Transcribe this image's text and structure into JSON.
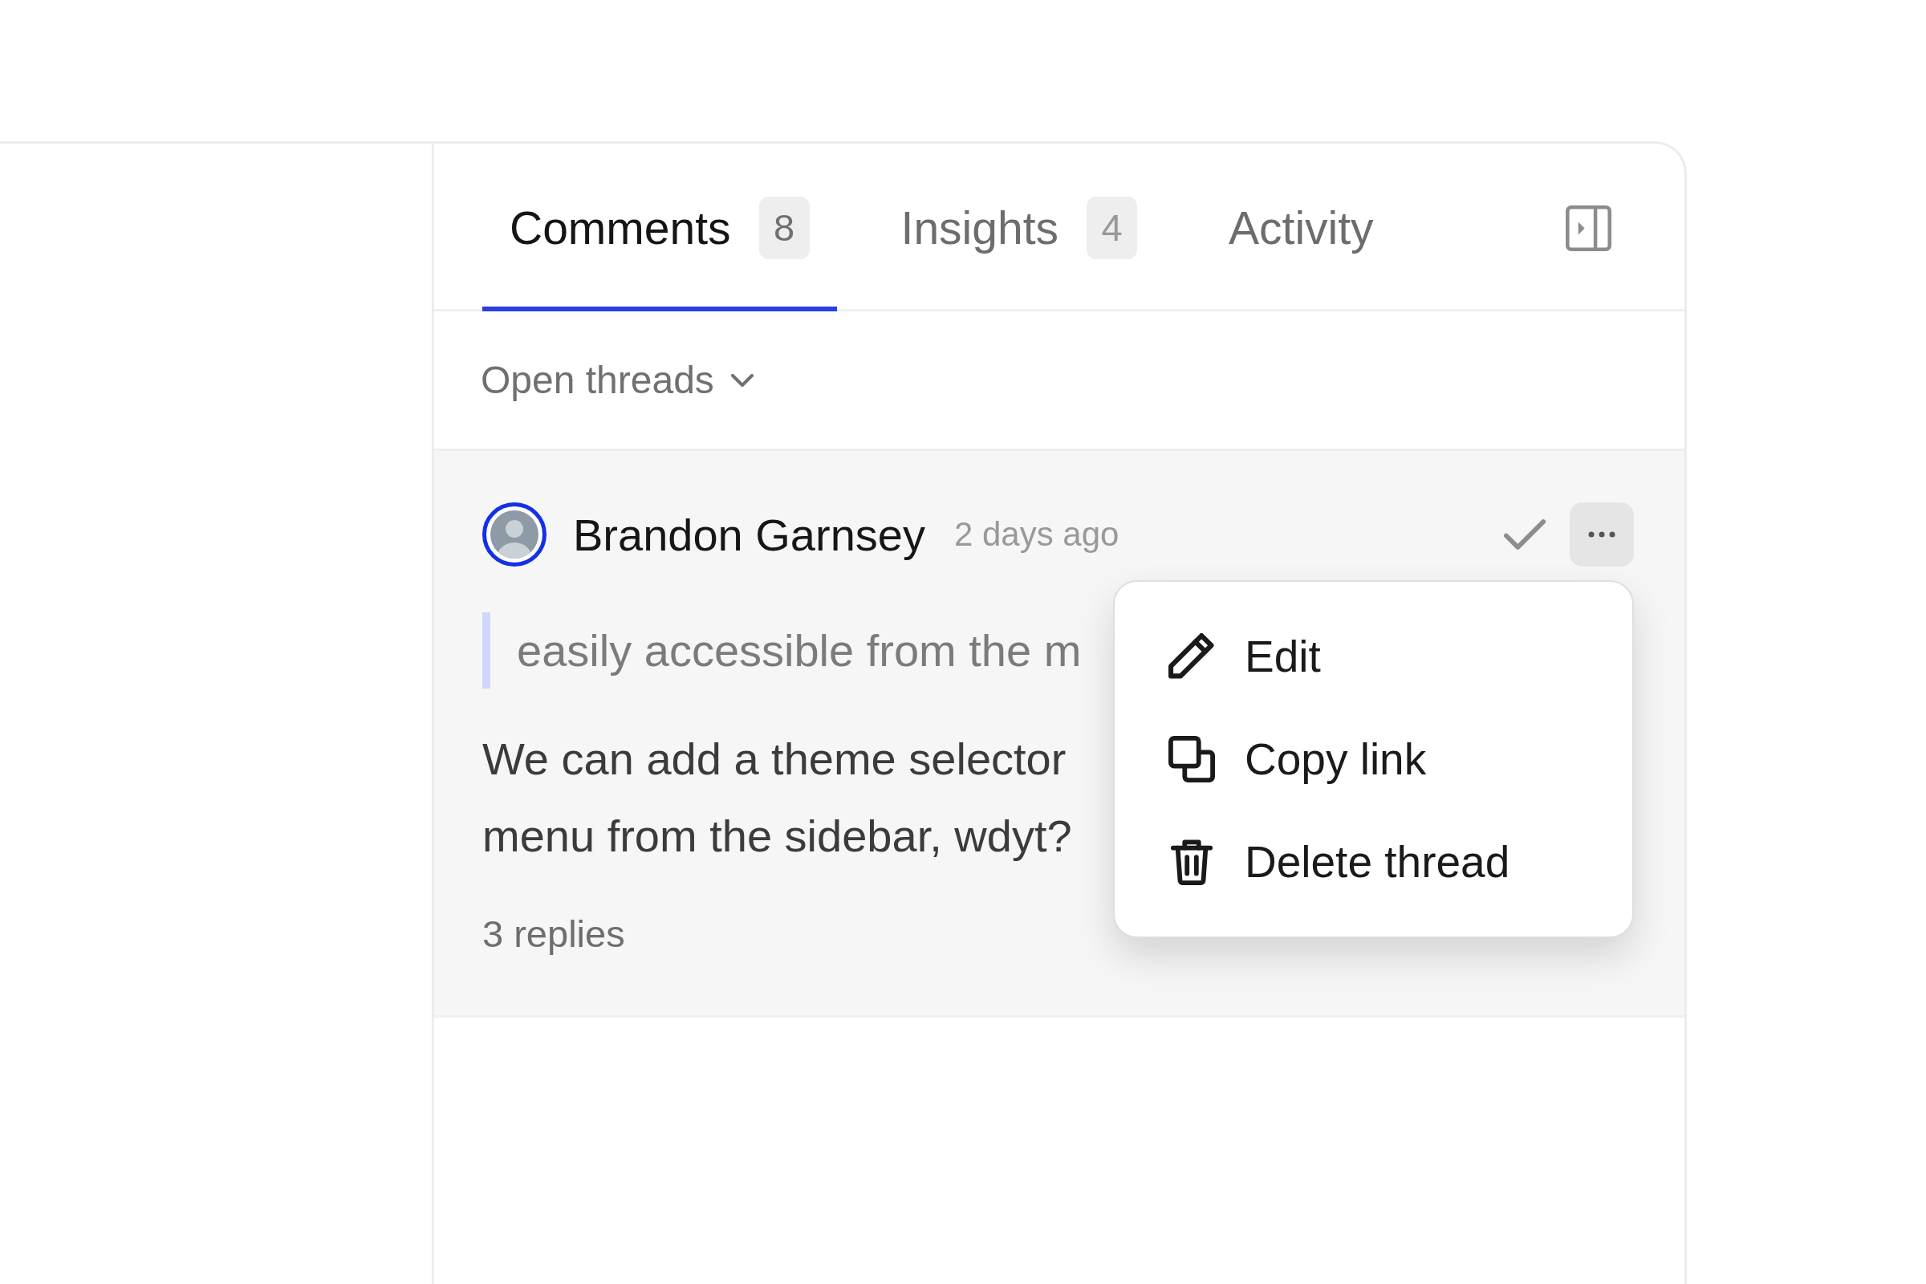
{
  "panel": {
    "tabs": [
      {
        "label": "Comments",
        "count": "8",
        "selected": true
      },
      {
        "label": "Insights",
        "count": "4",
        "selected": false
      },
      {
        "label": "Activity",
        "selected": false
      }
    ]
  },
  "filter": {
    "label": "Open threads"
  },
  "thread": {
    "author": "Brandon Garnsey",
    "time": "2 days ago",
    "quote": "easily accessible from the m",
    "body_lines": [
      "We can add a theme selector",
      "menu from the sidebar, wdyt?"
    ],
    "replies": "3 replies",
    "menu_open": true
  },
  "menu": {
    "items": [
      {
        "kind": "edit",
        "label": "Edit"
      },
      {
        "kind": "copy",
        "label": "Copy link"
      },
      {
        "kind": "delete",
        "label": "Delete thread"
      }
    ]
  }
}
